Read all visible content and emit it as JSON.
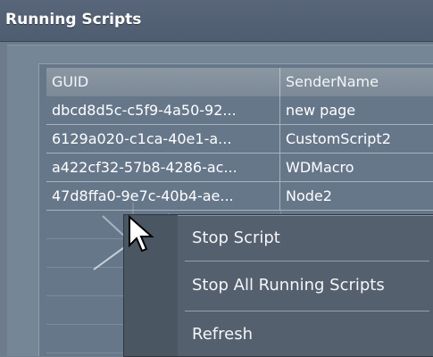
{
  "window": {
    "title": "Running Scripts"
  },
  "table": {
    "columns": [
      "GUID",
      "SenderName"
    ],
    "rows": [
      [
        "dbcd8d5c-c5f9-4a50-92...",
        "new page"
      ],
      [
        "6129a020-c1ca-40e1-a...",
        "CustomScript2"
      ],
      [
        "a422cf32-57b8-4286-ac...",
        "WDMacro"
      ],
      [
        "47d8ffa0-9e7c-40b4-ae...",
        "Node2"
      ]
    ]
  },
  "context_menu": {
    "items": [
      "Stop Script",
      "Stop All Running Scripts",
      "Refresh"
    ]
  },
  "icons": {
    "cursor": "arrow-cursor-icon"
  }
}
